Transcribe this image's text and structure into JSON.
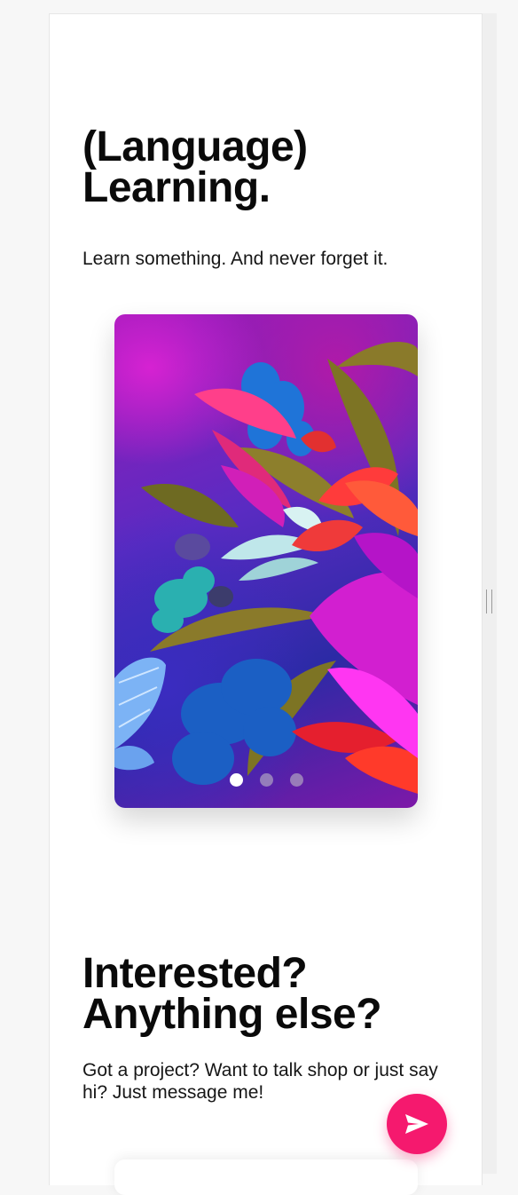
{
  "hero": {
    "title_line1": "(Language)",
    "title_line2": "Learning.",
    "subtitle": "Learn something. And never forget it."
  },
  "carousel": {
    "slide_count": 3,
    "active_index": 0,
    "image_description_icon": "floral-artwork-image"
  },
  "contact": {
    "title_line1": "Interested?",
    "title_line2": "Anything else?",
    "subtitle": "Got a project? Want to talk shop or just say hi? Just message me!"
  },
  "fab": {
    "icon": "send-icon",
    "color": "#f5196e"
  }
}
